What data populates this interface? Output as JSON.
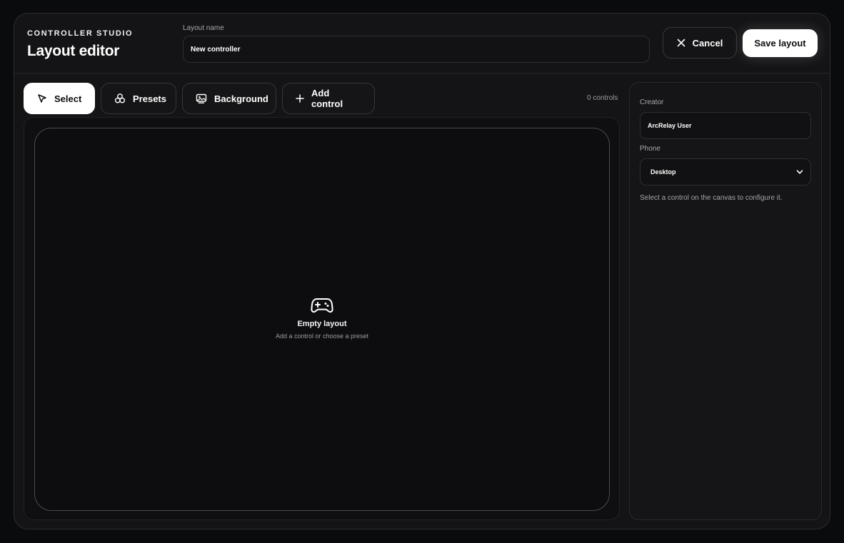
{
  "header": {
    "eyebrow": "CONTROLLER STUDIO",
    "title": "Layout editor",
    "layout_name_label": "Layout name",
    "layout_name_value": "New controller",
    "cancel_label": "Cancel",
    "save_label": "Save layout"
  },
  "toolbar": {
    "select_label": "Select",
    "presets_label": "Presets",
    "background_label": "Background",
    "add_control_label": "Add control",
    "active_tool": "Select",
    "controls_count": "0 controls"
  },
  "canvas": {
    "empty_icon": "gamepad-icon",
    "empty_title": "Empty layout",
    "empty_subtitle": "Add a control or choose a preset"
  },
  "panel": {
    "creator_label": "Creator",
    "creator_value": "ArcRelay User",
    "phone_label": "Phone",
    "phone_value": "Desktop",
    "hint": "Select a control on the canvas to configure it."
  },
  "colors": {
    "background": "#0a0b0d",
    "surface": "#141416",
    "accent": "#ffffff"
  }
}
